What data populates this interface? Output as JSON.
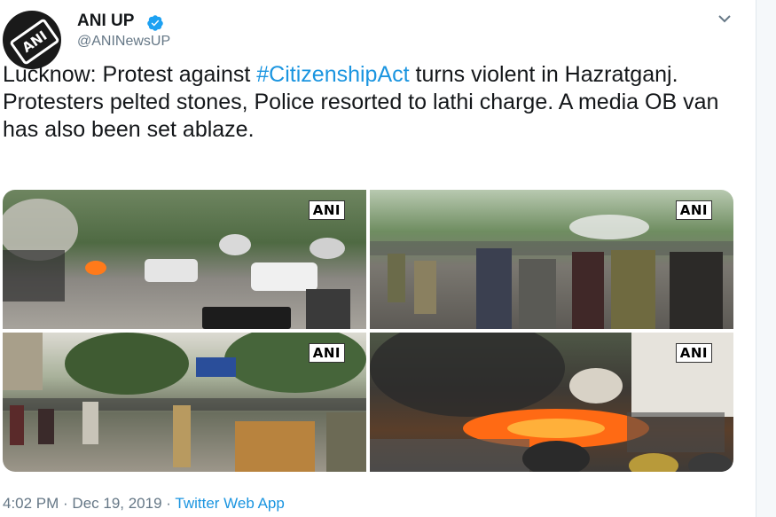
{
  "account": {
    "name": "ANI UP",
    "handle": "@ANINewsUP",
    "avatar_text": "ANI"
  },
  "tweet": {
    "text_before_hashtag": "Lucknow: Protest against ",
    "hashtag": "#CitizenshipAct",
    "text_after_hashtag": " turns violent in Hazratganj. Protesters pelted stones, Police resorted to lathi charge. A media OB van has also been set ablaze."
  },
  "media": {
    "watermarks": [
      "ANI",
      "ANI",
      "ANI",
      "ANI"
    ]
  },
  "footer": {
    "time": "4:02 PM",
    "separator": " · ",
    "date": "Dec 19, 2019",
    "source": "Twitter Web App"
  },
  "colors": {
    "link": "#1b95e0",
    "text": "#14171a",
    "muted": "#657786",
    "verified": "#1da1f2"
  },
  "icons": {
    "verified": "verified-badge-icon",
    "menu": "chevron-down-icon"
  }
}
